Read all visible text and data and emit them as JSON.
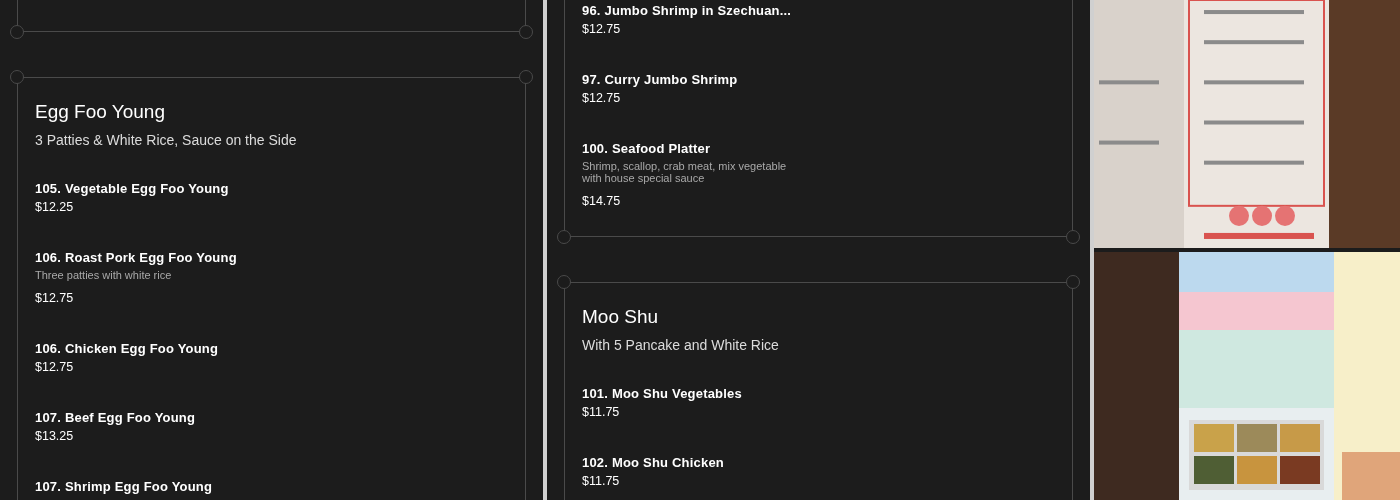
{
  "columns": [
    {
      "sections": [
        {
          "title": "Egg Foo Young",
          "subtitle": "3 Patties & White Rice, Sauce on the Side",
          "items": [
            {
              "name": "105. Vegetable Egg Foo Young",
              "price": "$12.25"
            },
            {
              "name": "106. Roast Pork Egg Foo Young",
              "description": "Three patties with white rice",
              "price": "$12.75"
            },
            {
              "name": "106. Chicken Egg Foo Young",
              "price": "$12.75"
            },
            {
              "name": "107. Beef Egg Foo Young",
              "price": "$13.25"
            },
            {
              "name": "107. Shrimp Egg Foo Young"
            }
          ]
        }
      ]
    },
    {
      "sections": [
        {
          "items": [
            {
              "name": "96. Jumbo Shrimp in Szechuan...",
              "price": "$12.75"
            },
            {
              "name": "97. Curry Jumbo Shrimp",
              "price": "$12.75"
            },
            {
              "name": "100. Seafood Platter",
              "description": "Shrimp, scallop, crab meat, mix vegetable with house special sauce",
              "price": "$14.75"
            }
          ]
        },
        {
          "title": "Moo Shu",
          "subtitle": "With 5 Pancake and White Rice",
          "items": [
            {
              "name": "101. Moo Shu Vegetables",
              "price": "$11.75"
            },
            {
              "name": "102. Moo Shu Chicken",
              "price": "$11.75"
            }
          ]
        }
      ]
    }
  ]
}
